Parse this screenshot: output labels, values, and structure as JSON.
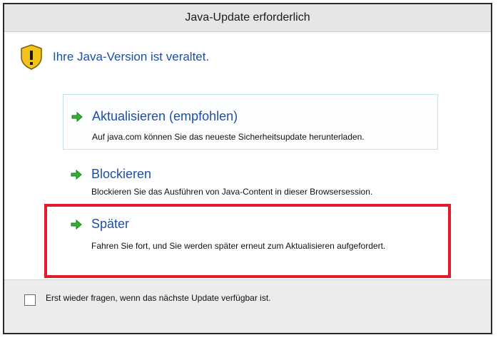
{
  "window": {
    "title": "Java-Update erforderlich"
  },
  "header": {
    "message": "Ihre Java-Version ist veraltet.",
    "icon": "warning-shield-icon"
  },
  "options": [
    {
      "title": "Aktualisieren (empfohlen)",
      "description": "Auf java.com können Sie das neueste Sicherheitsupdate herunterladen.",
      "icon": "green-arrow-icon"
    },
    {
      "title": "Blockieren",
      "description": "Blockieren Sie das Ausführen von Java-Content in dieser Browsersession.",
      "icon": "green-arrow-icon"
    },
    {
      "title": "Später",
      "description": "Fahren Sie fort, und Sie werden später erneut zum Aktualisieren aufgefordert.",
      "icon": "green-arrow-icon"
    }
  ],
  "footer": {
    "checkbox_label": "Erst wieder fragen, wenn das nächste Update verfügbar ist."
  },
  "colors": {
    "accent": "#1f4fa0",
    "highlight_border": "#e01a2b",
    "arrow": "#2fb52f"
  }
}
